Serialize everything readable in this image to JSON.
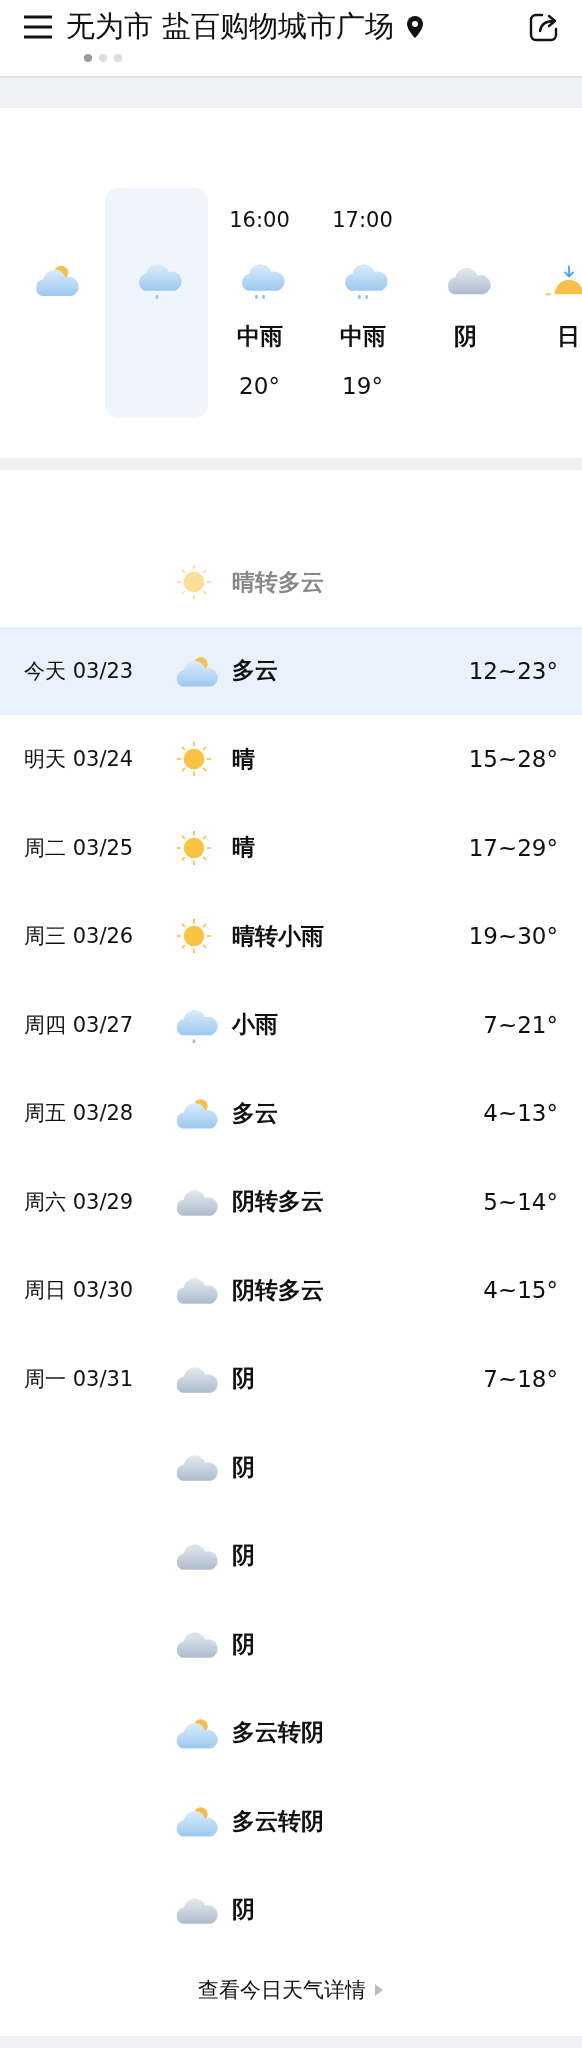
{
  "header": {
    "location": "无为市 盐百购物城市广场",
    "pages": [
      {
        "selected": true
      },
      {
        "selected": false
      },
      {
        "selected": false
      }
    ]
  },
  "hourly": [
    {
      "kind": "partly-cloudy",
      "selected": false
    },
    {
      "kind": "light-rain",
      "selected": true
    },
    {
      "time": "16:00",
      "kind": "rain",
      "condition": "中雨",
      "temp": "20°",
      "selected": false
    },
    {
      "time": "17:00",
      "kind": "rain",
      "condition": "中雨",
      "temp": "19°",
      "selected": false
    },
    {
      "kind": "overcast",
      "condition": "阴",
      "selected": false
    },
    {
      "kind": "sunrise",
      "condition": "日",
      "selected": false
    }
  ],
  "daily": [
    {
      "kind": "sunny",
      "condition": "晴转多云",
      "past": true,
      "selected": false
    },
    {
      "date": "今天 03/23",
      "kind": "partly-cloudy",
      "condition": "多云",
      "temp": "12~23°",
      "past": false,
      "selected": true
    },
    {
      "date": "明天 03/24",
      "kind": "sunny",
      "condition": "晴",
      "temp": "15~28°",
      "past": false,
      "selected": false
    },
    {
      "date": "周二 03/25",
      "kind": "sunny",
      "condition": "晴",
      "temp": "17~29°",
      "past": false,
      "selected": false
    },
    {
      "date": "周三 03/26",
      "kind": "sunny",
      "condition": "晴转小雨",
      "temp": "19~30°",
      "past": false,
      "selected": false
    },
    {
      "date": "周四 03/27",
      "kind": "light-rain",
      "condition": "小雨",
      "temp": "7~21°",
      "past": false,
      "selected": false
    },
    {
      "date": "周五 03/28",
      "kind": "partly-cloudy",
      "condition": "多云",
      "temp": "4~13°",
      "past": false,
      "selected": false
    },
    {
      "date": "周六 03/29",
      "kind": "overcast",
      "condition": "阴转多云",
      "temp": "5~14°",
      "past": false,
      "selected": false
    },
    {
      "date": "周日 03/30",
      "kind": "overcast",
      "condition": "阴转多云",
      "temp": "4~15°",
      "past": false,
      "selected": false
    },
    {
      "date": "周一 03/31",
      "kind": "overcast",
      "condition": "阴",
      "temp": "7~18°",
      "past": false,
      "selected": false
    },
    {
      "kind": "overcast",
      "condition": "阴",
      "past": false,
      "selected": false
    },
    {
      "kind": "overcast",
      "condition": "阴",
      "past": false,
      "selected": false
    },
    {
      "kind": "overcast",
      "condition": "阴",
      "past": false,
      "selected": false
    },
    {
      "kind": "partly-cloudy",
      "condition": "多云转阴",
      "past": false,
      "selected": false
    },
    {
      "kind": "partly-cloudy",
      "condition": "多云转阴",
      "past": false,
      "selected": false
    },
    {
      "kind": "overcast",
      "condition": "阴",
      "past": false,
      "selected": false
    }
  ],
  "details_link": "查看今日天气详情"
}
